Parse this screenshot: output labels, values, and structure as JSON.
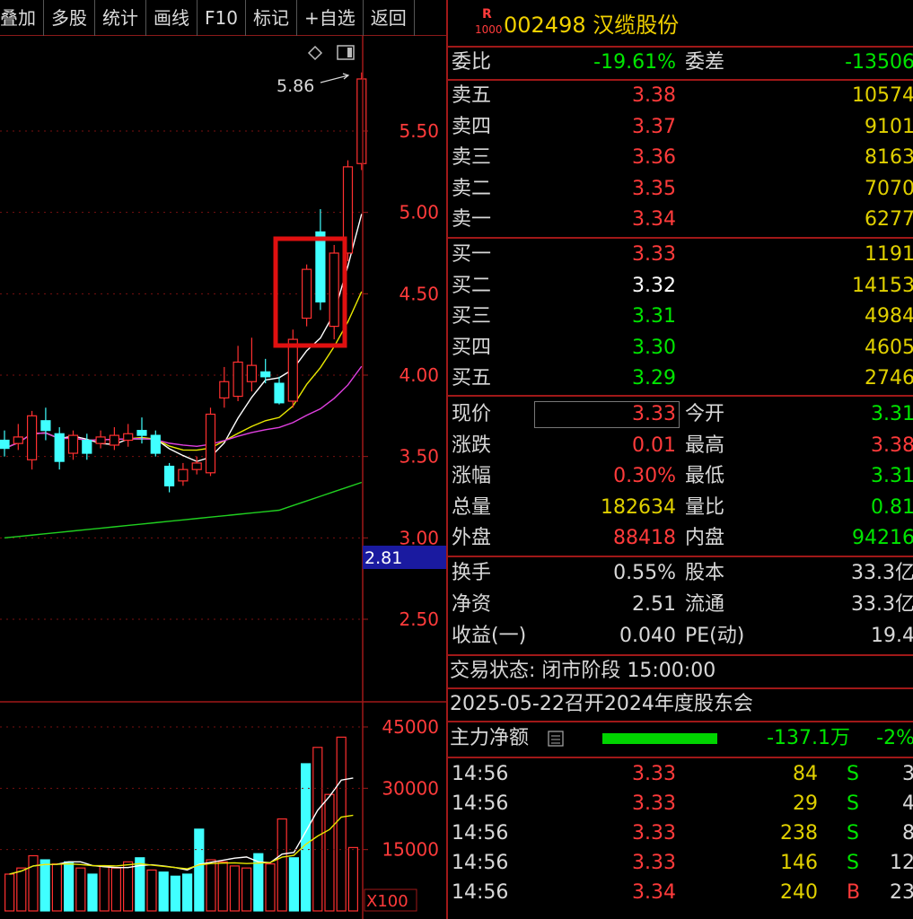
{
  "toolbar": {
    "items": [
      "叠加",
      "多股",
      "统计",
      "画线",
      "F10",
      "标记",
      "+自选",
      "返回"
    ]
  },
  "chart": {
    "price_ticks": [
      "5.50",
      "5.00",
      "4.50",
      "4.00",
      "3.50",
      "3.00",
      "2.50"
    ],
    "high_label": "5.86",
    "current_marker": "2.81",
    "volume_ticks": [
      "45000",
      "30000",
      "15000"
    ],
    "volume_unit": "X100",
    "icons": {
      "diamond": "diamond-icon",
      "panel": "panel-toggle-icon"
    }
  },
  "chart_data": {
    "type": "candlestick",
    "price_ylim": [
      2.3,
      6.0
    ],
    "candles": [
      {
        "o": 3.6,
        "c": 3.55,
        "h": 3.66,
        "l": 3.5
      },
      {
        "o": 3.58,
        "c": 3.62,
        "h": 3.7,
        "l": 3.54
      },
      {
        "o": 3.48,
        "c": 3.75,
        "h": 3.78,
        "l": 3.42
      },
      {
        "o": 3.72,
        "c": 3.66,
        "h": 3.8,
        "l": 3.6
      },
      {
        "o": 3.64,
        "c": 3.47,
        "h": 3.68,
        "l": 3.42
      },
      {
        "o": 3.52,
        "c": 3.63,
        "h": 3.66,
        "l": 3.48
      },
      {
        "o": 3.6,
        "c": 3.52,
        "h": 3.64,
        "l": 3.48
      },
      {
        "o": 3.58,
        "c": 3.62,
        "h": 3.66,
        "l": 3.55
      },
      {
        "o": 3.57,
        "c": 3.63,
        "h": 3.68,
        "l": 3.54
      },
      {
        "o": 3.6,
        "c": 3.64,
        "h": 3.7,
        "l": 3.56
      },
      {
        "o": 3.66,
        "c": 3.63,
        "h": 3.74,
        "l": 3.58
      },
      {
        "o": 3.63,
        "c": 3.52,
        "h": 3.66,
        "l": 3.5
      },
      {
        "o": 3.44,
        "c": 3.32,
        "h": 3.46,
        "l": 3.28
      },
      {
        "o": 3.35,
        "c": 3.42,
        "h": 3.46,
        "l": 3.32
      },
      {
        "o": 3.42,
        "c": 3.46,
        "h": 3.5,
        "l": 3.39
      },
      {
        "o": 3.4,
        "c": 3.76,
        "h": 3.8,
        "l": 3.38
      },
      {
        "o": 3.86,
        "c": 3.96,
        "h": 4.05,
        "l": 3.8
      },
      {
        "o": 3.87,
        "c": 4.08,
        "h": 4.18,
        "l": 3.84
      },
      {
        "o": 3.96,
        "c": 4.06,
        "h": 4.23,
        "l": 3.9
      },
      {
        "o": 4.02,
        "c": 3.99,
        "h": 4.1,
        "l": 3.95
      },
      {
        "o": 3.95,
        "c": 3.83,
        "h": 3.99,
        "l": 3.82
      },
      {
        "o": 3.84,
        "c": 4.22,
        "h": 4.28,
        "l": 3.8
      },
      {
        "o": 4.35,
        "c": 4.65,
        "h": 4.68,
        "l": 4.3
      },
      {
        "o": 4.88,
        "c": 4.45,
        "h": 5.02,
        "l": 4.4
      },
      {
        "o": 4.3,
        "c": 4.75,
        "h": 4.8,
        "l": 4.22
      },
      {
        "o": 4.75,
        "c": 5.28,
        "h": 5.32,
        "l": 4.7
      },
      {
        "o": 5.3,
        "c": 5.82,
        "h": 5.86,
        "l": 5.26
      }
    ],
    "volume_ylim": [
      0,
      50000
    ],
    "volumes": [
      9000,
      10500,
      13500,
      12500,
      11500,
      12000,
      10500,
      9000,
      11000,
      10500,
      12000,
      13000,
      10000,
      9500,
      8500,
      9000,
      20000,
      12500,
      12000,
      11000,
      10500,
      14000,
      11500,
      22500,
      13000,
      36000,
      40000,
      28500,
      42500,
      15500
    ],
    "volume_up": [
      1,
      1,
      1,
      0,
      1,
      0,
      1,
      0,
      1,
      1,
      1,
      0,
      1,
      0,
      0,
      0,
      0,
      1,
      1,
      1,
      1,
      0,
      1,
      1,
      0,
      0,
      1,
      1,
      1,
      1
    ]
  },
  "panel": {
    "badge_top": "R",
    "badge_bottom": "1000",
    "stock_title": "002498 汉缆股份",
    "wei_bi_label": "委比",
    "wei_bi": "-19.61%",
    "wei_cha_label": "委差",
    "wei_cha": "-13506",
    "asks": [
      {
        "label": "卖五",
        "price": "3.38",
        "vol": "10574"
      },
      {
        "label": "卖四",
        "price": "3.37",
        "vol": "9101"
      },
      {
        "label": "卖三",
        "price": "3.36",
        "vol": "8163"
      },
      {
        "label": "卖二",
        "price": "3.35",
        "vol": "7070"
      },
      {
        "label": "卖一",
        "price": "3.34",
        "vol": "6277"
      }
    ],
    "bids": [
      {
        "label": "买一",
        "price": "3.33",
        "vol": "1191"
      },
      {
        "label": "买二",
        "price": "3.32",
        "vol": "14153"
      },
      {
        "label": "买三",
        "price": "3.31",
        "vol": "4984"
      },
      {
        "label": "买四",
        "price": "3.30",
        "vol": "4605"
      },
      {
        "label": "买五",
        "price": "3.29",
        "vol": "2746"
      }
    ],
    "stats": [
      {
        "l1": "现价",
        "v1": "3.33",
        "l2": "今开",
        "v2": "3.31"
      },
      {
        "l1": "涨跌",
        "v1": "0.01",
        "l2": "最高",
        "v2": "3.38"
      },
      {
        "l1": "涨幅",
        "v1": "0.30%",
        "l2": "最低",
        "v2": "3.31"
      },
      {
        "l1": "总量",
        "v1": "182634",
        "l2": "量比",
        "v2": "0.81"
      },
      {
        "l1": "外盘",
        "v1": "88418",
        "l2": "内盘",
        "v2": "94216"
      }
    ],
    "fundamentals": [
      {
        "l1": "换手",
        "v1": "0.55%",
        "l2": "股本",
        "v2": "33.3亿"
      },
      {
        "l1": "净资",
        "v1": "2.51",
        "l2": "流通",
        "v2": "33.3亿"
      },
      {
        "l1": "收益(一)",
        "v1": "0.040",
        "l2": "PE(动)",
        "v2": "19.4"
      }
    ],
    "trade_status": "交易状态: 闭市阶段 15:00:00",
    "notice": "2025-05-22召开2024年度股东会",
    "main_flow_label": "主力净额",
    "main_flow_value": "-137.1万",
    "main_flow_pct": "-2%",
    "ticks": [
      {
        "time": "14:56",
        "price": "3.33",
        "vol": "84",
        "side": "S",
        "n": "3"
      },
      {
        "time": "14:56",
        "price": "3.33",
        "vol": "29",
        "side": "S",
        "n": "4"
      },
      {
        "time": "14:56",
        "price": "3.33",
        "vol": "238",
        "side": "S",
        "n": "8"
      },
      {
        "time": "14:56",
        "price": "3.33",
        "vol": "146",
        "side": "S",
        "n": "12"
      },
      {
        "time": "14:56",
        "price": "3.34",
        "vol": "240",
        "side": "B",
        "n": "23"
      }
    ]
  }
}
